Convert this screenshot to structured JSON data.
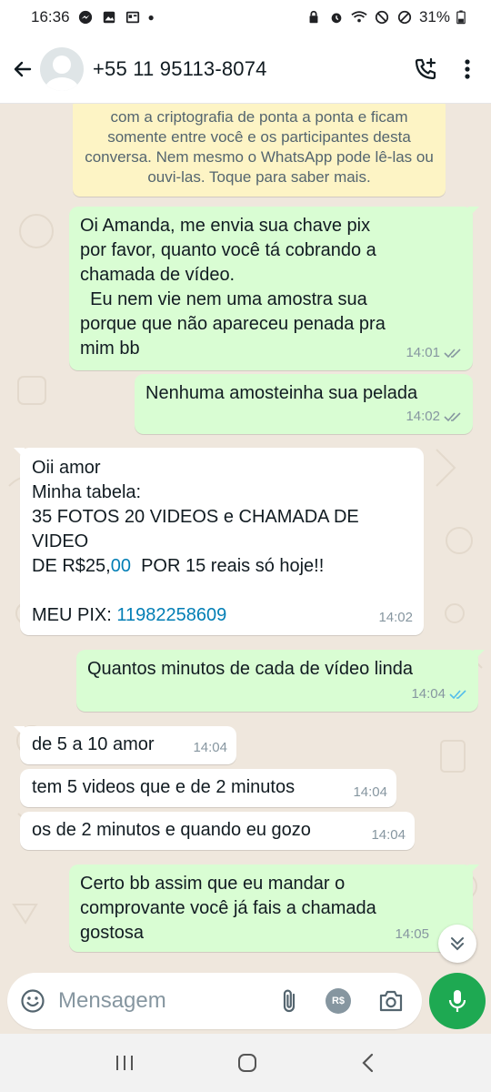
{
  "status_bar": {
    "time": "16:36",
    "battery": "31%"
  },
  "header": {
    "contact": "+55 11 95113-8074"
  },
  "encryption_notice": "com a criptografia de ponta a ponta e ficam somente entre você e os participantes desta conversa. Nem mesmo o WhatsApp pode lê-las ou ouvi-las. Toque para saber mais.",
  "messages": [
    {
      "dir": "out",
      "text": "Oi Amanda, me envia sua chave pix\npor favor, quanto você tá cobrando a\nchamada de vídeo.\n  Eu nem vie nem uma amostra sua\nporque que não apareceu penada pra\nmim bb",
      "time": "14:01",
      "status": "delivered"
    },
    {
      "dir": "out",
      "text": "Nenhuma amosteinha sua pelada",
      "time": "14:02",
      "status": "delivered"
    },
    {
      "dir": "in",
      "text_lines": [
        "Oii amor",
        "Minha tabela:",
        "35 FOTOS 20 VIDEOS e CHAMADA DE",
        "VIDEO"
      ],
      "price_prefix": "DE R$25,",
      "price_link": "00",
      "price_suffix": "  POR 15 reais só hoje!!",
      "pix_label": "MEU PIX: ",
      "pix_value": "11982258609",
      "time": "14:02"
    },
    {
      "dir": "out",
      "text": "Quantos minutos de cada de vídeo linda",
      "time": "14:04",
      "status": "read"
    },
    {
      "dir": "in",
      "text": "de 5 a 10 amor",
      "time": "14:04"
    },
    {
      "dir": "in",
      "text": "tem 5 videos que e de 2 minutos",
      "time": "14:04"
    },
    {
      "dir": "in",
      "text": "os de 2 minutos e quando eu gozo",
      "time": "14:04"
    },
    {
      "dir": "out",
      "text": "Certo bb assim que eu mandar o\ncomprovante você já fais a chamada\ngostosa",
      "time": "14:05"
    }
  ],
  "composer": {
    "placeholder": "Mensagem",
    "currency_badge": "R$"
  },
  "colors": {
    "outgoing": "#d9fdd3",
    "incoming": "#ffffff",
    "accent": "#1ea952",
    "read_tick": "#53bdeb",
    "link": "#027eb5"
  }
}
